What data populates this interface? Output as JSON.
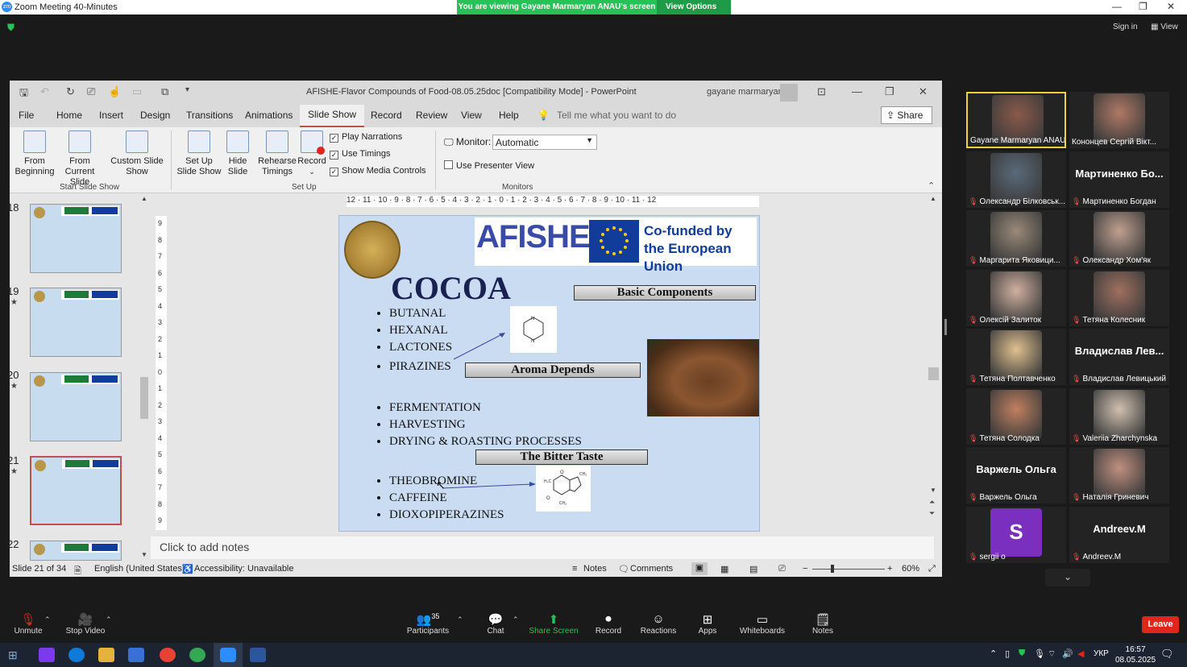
{
  "zoom": {
    "window_title": "Zoom Meeting 40-Minutes",
    "banner": "You are viewing Gayane Marmaryan ANAU's screen",
    "view_options": "View Options",
    "sign_in": "Sign in",
    "view": "View"
  },
  "ppt": {
    "title": "AFISHE-Flavor Compounds of Food-08.05.25doc [Compatibility Mode]  -  PowerPoint",
    "user": "gayane marmaryan",
    "tabs": [
      "File",
      "Home",
      "Insert",
      "Design",
      "Transitions",
      "Animations",
      "Slide Show",
      "Record",
      "Review",
      "View",
      "Help"
    ],
    "tell_me": "Tell me what you want to do",
    "share": "Share",
    "ribbon": {
      "from_beginning": "From Beginning",
      "from_current": "From Current Slide",
      "custom_show": "Custom Slide Show",
      "group_start": "Start Slide Show",
      "setup_show": "Set Up Slide Show",
      "hide_slide": "Hide Slide",
      "rehearse": "Rehearse Timings",
      "record": "Record",
      "play_narrations": "Play Narrations",
      "use_timings": "Use Timings",
      "show_media": "Show Media Controls",
      "group_setup": "Set Up",
      "monitor_label": "Monitor:",
      "monitor_value": "Automatic",
      "presenter_view": "Use Presenter View",
      "group_monitors": "Monitors"
    },
    "thumb_numbers": [
      "18",
      "19",
      "20",
      "21",
      "22"
    ],
    "ruler_h": "12 · 11 · 10 · 9 · 8 · 7 · 6 · 5 · 4 · 3 · 2 · 1 · 0 · 1 · 2 · 3 · 4 · 5 · 6 · 7 · 8 · 9 · 10 · 11 · 12",
    "notes_placeholder": "Click to add notes",
    "status": {
      "slide": "Slide 21 of 34",
      "language": "English (United States)",
      "accessibility": "Accessibility: Unavailable",
      "notes": "Notes",
      "comments": "Comments",
      "zoom": "60%"
    }
  },
  "slide": {
    "afishe": "AFISHE",
    "eu_line1": "Co-funded by",
    "eu_line2": "the European Union",
    "title": "COCOA",
    "box_basic": "Basic Components",
    "list1": [
      "BUTANAL",
      "HEXANAL",
      "LACTONES",
      "PIRAZINES"
    ],
    "box_aroma": "Aroma Depends",
    "list2": [
      "FERMENTATION",
      "HARVESTING",
      "DRYING & ROASTING PROCESSES"
    ],
    "box_bitter": "The Bitter Taste",
    "list3": [
      "THEOBROMINE",
      "CAFFEINE",
      "DIOXOPIPERAZINES"
    ]
  },
  "participants": [
    {
      "name": "Gayane Marmaryan ANAU",
      "video": true,
      "muted": false,
      "active": true
    },
    {
      "name": "Кононцев Сергій Вікт...",
      "video": true,
      "muted": false
    },
    {
      "name": "Олександр Білковськ...",
      "video": true,
      "muted": true
    },
    {
      "name": "Мартиненко Богдан",
      "big": "Мартиненко  Бо...",
      "video": false,
      "muted": true
    },
    {
      "name": "Маргарита Яковици...",
      "video": true,
      "muted": true
    },
    {
      "name": "Олександр Хом'як",
      "video": true,
      "muted": true
    },
    {
      "name": "Олексій Залиток",
      "video": true,
      "muted": true
    },
    {
      "name": "Тетяна Колесник",
      "video": true,
      "muted": true
    },
    {
      "name": "Тетяна Полтавченко",
      "video": true,
      "muted": true
    },
    {
      "name": "Владислав Левицький",
      "big": "Владислав  Лев...",
      "video": false,
      "muted": true
    },
    {
      "name": "Тетяна Солодка",
      "video": true,
      "muted": true
    },
    {
      "name": "Valeriia Zharchynska",
      "video": true,
      "muted": true
    },
    {
      "name": "Варжель Ольга",
      "big": "Варжель  Ольга",
      "video": false,
      "muted": true
    },
    {
      "name": "Наталія Гриневич",
      "video": true,
      "muted": true
    },
    {
      "name": "sergii o",
      "big": "S",
      "video": false,
      "muted": true,
      "avatar": true
    },
    {
      "name": "Andreev.M",
      "big": "Andreev.M",
      "video": false,
      "muted": true
    }
  ],
  "toolbar": {
    "unmute": "Unmute",
    "stop_video": "Stop Video",
    "participants": "Participants",
    "participants_count": "35",
    "chat": "Chat",
    "share_screen": "Share Screen",
    "record": "Record",
    "reactions": "Reactions",
    "apps": "Apps",
    "whiteboards": "Whiteboards",
    "notes": "Notes",
    "leave": "Leave"
  },
  "taskbar": {
    "lang": "УКР",
    "time": "16:57",
    "date": "08.05.2025"
  },
  "colors": {
    "zoom_green": "#26c257",
    "leave_red": "#e0251b",
    "ppt_accent": "#c0504d",
    "active_speaker": "#f2d03a"
  }
}
